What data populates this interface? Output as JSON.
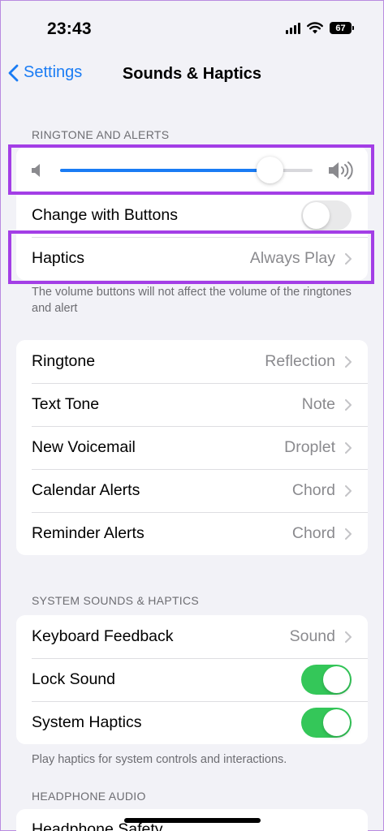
{
  "status": {
    "time": "23:43",
    "battery": "67"
  },
  "nav": {
    "back_label": "Settings",
    "title": "Sounds & Haptics"
  },
  "ringtone_section": {
    "header": "RINGTONE AND ALERTS",
    "volume_level": 0.83,
    "change_with_buttons": {
      "label": "Change with Buttons",
      "on": false
    },
    "haptics": {
      "label": "Haptics",
      "value": "Always Play"
    },
    "footer": "The volume buttons will not affect the volume of the ringtones and alert"
  },
  "tones": [
    {
      "label": "Ringtone",
      "value": "Reflection"
    },
    {
      "label": "Text Tone",
      "value": "Note"
    },
    {
      "label": "New Voicemail",
      "value": "Droplet"
    },
    {
      "label": "Calendar Alerts",
      "value": "Chord"
    },
    {
      "label": "Reminder Alerts",
      "value": "Chord"
    }
  ],
  "system_section": {
    "header": "SYSTEM SOUNDS & HAPTICS",
    "keyboard_feedback": {
      "label": "Keyboard Feedback",
      "value": "Sound"
    },
    "lock_sound": {
      "label": "Lock Sound",
      "on": true
    },
    "system_haptics": {
      "label": "System Haptics",
      "on": true
    },
    "footer": "Play haptics for system controls and interactions."
  },
  "headphone_section": {
    "header": "HEADPHONE AUDIO",
    "headphone_safety": {
      "label": "Headphone Safety"
    }
  },
  "colors": {
    "accent": "#1a7cf4",
    "toggle_on": "#34c759",
    "highlight": "#a33ee6"
  },
  "icons": [
    "signal-icon",
    "wifi-icon",
    "battery-icon",
    "back-chevron-icon",
    "speaker-low-icon",
    "speaker-high-icon",
    "chevron-right-icon"
  ]
}
